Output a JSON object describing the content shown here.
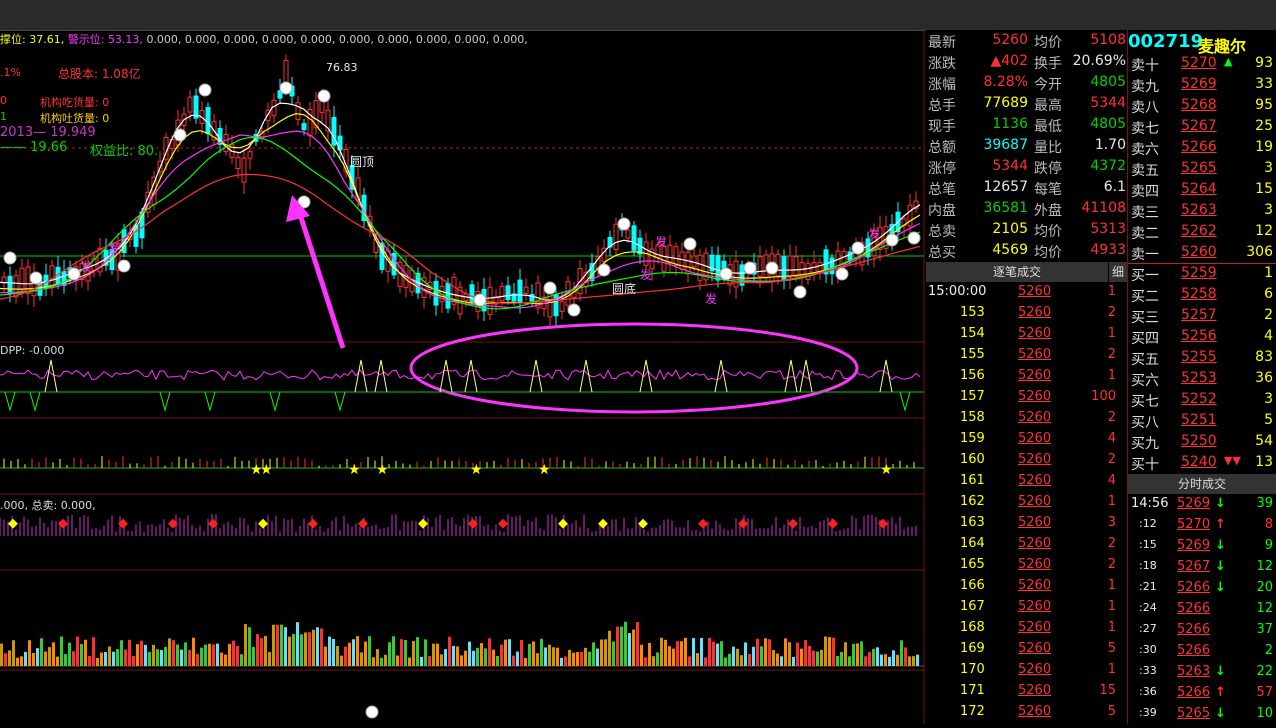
{
  "main_info": {
    "support_label": "撑位:",
    "support_value": "37.61,",
    "warning_label": "警示位:",
    "warning_value": "53.13,",
    "zeros": "0.000, 0.000, 0.000, 0.000, 0.000, 0.000, 0.000, 0.000, 0.000, 0.000,",
    "pct": ".1%",
    "total_capital": "总股本: 1.08亿",
    "inst_buy": "机构吃货量: 0",
    "inst_buy_prefix": "0",
    "inst_sell": "机构吐货量: 0",
    "inst_sell_prefix": "1",
    "line2013": "2013— 19.949",
    "ratio_line": "—— 19.66",
    "equity_ratio": "权益比: 80.",
    "peak_label": "76.83",
    "round_top": "圆顶",
    "round_bottom": "圆底",
    "fa_labels": [
      "发",
      "发",
      "发",
      "发",
      "发",
      "发"
    ]
  },
  "panels": {
    "dpp": "DPP: -0.000",
    "sell_total": ".000, 总卖: 0.000,"
  },
  "quote": {
    "code": "002719",
    "name": "麦趣尔",
    "rows": [
      {
        "l1": "最新",
        "v1": "5260",
        "c1": "red",
        "l2": "均价",
        "v2": "5108",
        "c2": "red"
      },
      {
        "l1": "涨跌",
        "v1": "▲402",
        "c1": "red",
        "l2": "换手",
        "v2": "20.69%",
        "c2": "white"
      },
      {
        "l1": "涨幅",
        "v1": "8.28%",
        "c1": "red",
        "l2": "今开",
        "v2": "4805",
        "c2": "green"
      },
      {
        "l1": "总手",
        "v1": "77689",
        "c1": "yellow",
        "l2": "最高",
        "v2": "5344",
        "c2": "red"
      },
      {
        "l1": "现手",
        "v1": "1136",
        "c1": "green",
        "l2": "最低",
        "v2": "4805",
        "c2": "green"
      },
      {
        "l1": "总额",
        "v1": "39687",
        "c1": "cyan",
        "l2": "量比",
        "v2": "1.70",
        "c2": "white"
      },
      {
        "l1": "涨停",
        "v1": "5344",
        "c1": "red",
        "l2": "跌停",
        "v2": "4372",
        "c2": "green"
      },
      {
        "l1": "总笔",
        "v1": "12657",
        "c1": "white",
        "l2": "每笔",
        "v2": "6.1",
        "c2": "white"
      },
      {
        "l1": "内盘",
        "v1": "36581",
        "c1": "green",
        "l2": "外盘",
        "v2": "41108",
        "c2": "red"
      },
      {
        "l1": "总卖",
        "v1": "2105",
        "c1": "yellow",
        "l2": "均价",
        "v2": "5313",
        "c2": "red"
      },
      {
        "l1": "总买",
        "v1": "4569",
        "c1": "yellow",
        "l2": "均价",
        "v2": "4933",
        "c2": "red"
      }
    ],
    "tick_title": "逐笔成交",
    "tick_detail": "细",
    "ticks": [
      {
        "t": "15:00:00",
        "p": "5260",
        "v": "1"
      },
      {
        "t": "153",
        "p": "5260",
        "v": "2"
      },
      {
        "t": "154",
        "p": "5260",
        "v": "1"
      },
      {
        "t": "155",
        "p": "5260",
        "v": "2"
      },
      {
        "t": "156",
        "p": "5260",
        "v": "1"
      },
      {
        "t": "157",
        "p": "5260",
        "v": "100"
      },
      {
        "t": "158",
        "p": "5260",
        "v": "2"
      },
      {
        "t": "159",
        "p": "5260",
        "v": "4"
      },
      {
        "t": "160",
        "p": "5260",
        "v": "2"
      },
      {
        "t": "161",
        "p": "5260",
        "v": "4"
      },
      {
        "t": "162",
        "p": "5260",
        "v": "1"
      },
      {
        "t": "163",
        "p": "5260",
        "v": "3"
      },
      {
        "t": "164",
        "p": "5260",
        "v": "2"
      },
      {
        "t": "165",
        "p": "5260",
        "v": "2"
      },
      {
        "t": "166",
        "p": "5260",
        "v": "1"
      },
      {
        "t": "167",
        "p": "5260",
        "v": "1"
      },
      {
        "t": "168",
        "p": "5260",
        "v": "1"
      },
      {
        "t": "169",
        "p": "5260",
        "v": "5"
      },
      {
        "t": "170",
        "p": "5260",
        "v": "1"
      },
      {
        "t": "171",
        "p": "5260",
        "v": "15"
      },
      {
        "t": "172",
        "p": "5260",
        "v": "5"
      }
    ],
    "sells": [
      {
        "l": "卖十",
        "p": "5270",
        "a": "▲",
        "v": "93"
      },
      {
        "l": "卖九",
        "p": "5269",
        "a": "",
        "v": "33"
      },
      {
        "l": "卖八",
        "p": "5268",
        "a": "",
        "v": "95"
      },
      {
        "l": "卖七",
        "p": "5267",
        "a": "",
        "v": "25"
      },
      {
        "l": "卖六",
        "p": "5266",
        "a": "",
        "v": "19"
      },
      {
        "l": "卖五",
        "p": "5265",
        "a": "",
        "v": "3"
      },
      {
        "l": "卖四",
        "p": "5264",
        "a": "",
        "v": "15"
      },
      {
        "l": "卖三",
        "p": "5263",
        "a": "",
        "v": "3"
      },
      {
        "l": "卖二",
        "p": "5262",
        "a": "",
        "v": "12"
      },
      {
        "l": "卖一",
        "p": "5260",
        "a": "",
        "v": "306"
      }
    ],
    "buys": [
      {
        "l": "买一",
        "p": "5259",
        "a": "",
        "v": "1"
      },
      {
        "l": "买二",
        "p": "5258",
        "a": "",
        "v": "6"
      },
      {
        "l": "买三",
        "p": "5257",
        "a": "",
        "v": "2"
      },
      {
        "l": "买四",
        "p": "5256",
        "a": "",
        "v": "4"
      },
      {
        "l": "买五",
        "p": "5255",
        "a": "",
        "v": "83"
      },
      {
        "l": "买六",
        "p": "5253",
        "a": "",
        "v": "36"
      },
      {
        "l": "买七",
        "p": "5252",
        "a": "",
        "v": "3"
      },
      {
        "l": "买八",
        "p": "5251",
        "a": "",
        "v": "5"
      },
      {
        "l": "买九",
        "p": "5250",
        "a": "",
        "v": "54"
      },
      {
        "l": "买十",
        "p": "5240",
        "a": "▼▼",
        "v": "13"
      }
    ],
    "minute_title": "分时成交",
    "minute": [
      {
        "t": "14:56",
        "p": "5269",
        "a": "↓",
        "v": "39"
      },
      {
        "t": ":12",
        "p": "5270",
        "a": "↑",
        "v": "8"
      },
      {
        "t": ":15",
        "p": "5269",
        "a": "↓",
        "v": "9"
      },
      {
        "t": ":18",
        "p": "5267",
        "a": "↓",
        "v": "12"
      },
      {
        "t": ":21",
        "p": "5266",
        "a": "↓",
        "v": "20"
      },
      {
        "t": ":24",
        "p": "5266",
        "a": "",
        "v": "12"
      },
      {
        "t": ":27",
        "p": "5266",
        "a": "",
        "v": "37"
      },
      {
        "t": ":30",
        "p": "5266",
        "a": "",
        "v": "2"
      },
      {
        "t": ":33",
        "p": "5263",
        "a": "↓",
        "v": "22"
      },
      {
        "t": ":36",
        "p": "5266",
        "a": "↑",
        "v": "57"
      },
      {
        "t": ":39",
        "p": "5265",
        "a": "↓",
        "v": "10"
      }
    ]
  },
  "colors": {
    "up": "#ff3030",
    "down": "#00ffff",
    "bg": "#000000",
    "grid": "#7a1010",
    "magenta": "#ff33ff"
  }
}
